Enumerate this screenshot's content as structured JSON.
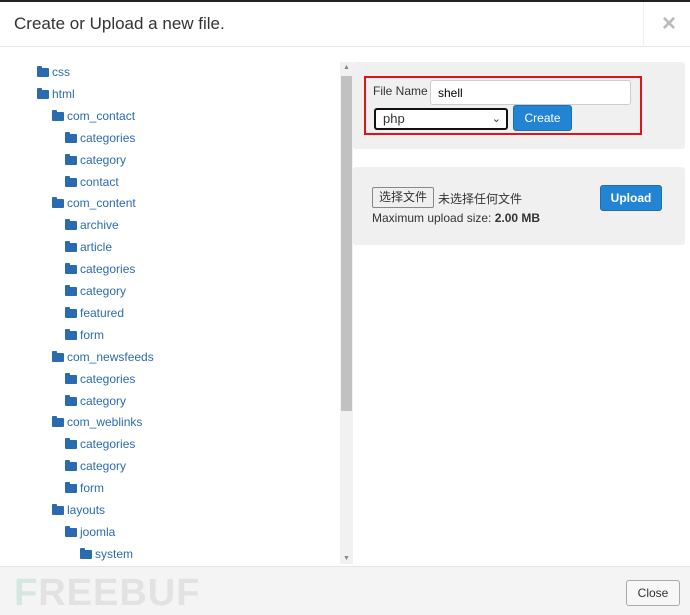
{
  "dialog": {
    "title": "Create or Upload a new file.",
    "close_icon": "×"
  },
  "tree": [
    {
      "label": "css",
      "level": 0
    },
    {
      "label": "html",
      "level": 0
    },
    {
      "label": "com_contact",
      "level": 1
    },
    {
      "label": "categories",
      "level": 2
    },
    {
      "label": "category",
      "level": 2
    },
    {
      "label": "contact",
      "level": 2
    },
    {
      "label": "com_content",
      "level": 1
    },
    {
      "label": "archive",
      "level": 2
    },
    {
      "label": "article",
      "level": 2
    },
    {
      "label": "categories",
      "level": 2
    },
    {
      "label": "category",
      "level": 2
    },
    {
      "label": "featured",
      "level": 2
    },
    {
      "label": "form",
      "level": 2
    },
    {
      "label": "com_newsfeeds",
      "level": 1
    },
    {
      "label": "categories",
      "level": 2
    },
    {
      "label": "category",
      "level": 2
    },
    {
      "label": "com_weblinks",
      "level": 1
    },
    {
      "label": "categories",
      "level": 2
    },
    {
      "label": "category",
      "level": 2
    },
    {
      "label": "form",
      "level": 2
    },
    {
      "label": "layouts",
      "level": 1
    },
    {
      "label": "joomla",
      "level": 2
    },
    {
      "label": "system",
      "level": 3
    }
  ],
  "create": {
    "label": "File Name",
    "value": "shell",
    "type_selected": "php",
    "button": "Create"
  },
  "upload": {
    "choose_button": "选择文件",
    "no_file": "未选择任何文件",
    "max_label": "Maximum upload size:",
    "max_value": "2.00 MB",
    "button": "Upload"
  },
  "footer": {
    "close": "Close",
    "watermark": "FREEBUF"
  },
  "colors": {
    "accent": "#2384d3",
    "highlight": "#e0121b",
    "link": "#2a6bb0"
  }
}
